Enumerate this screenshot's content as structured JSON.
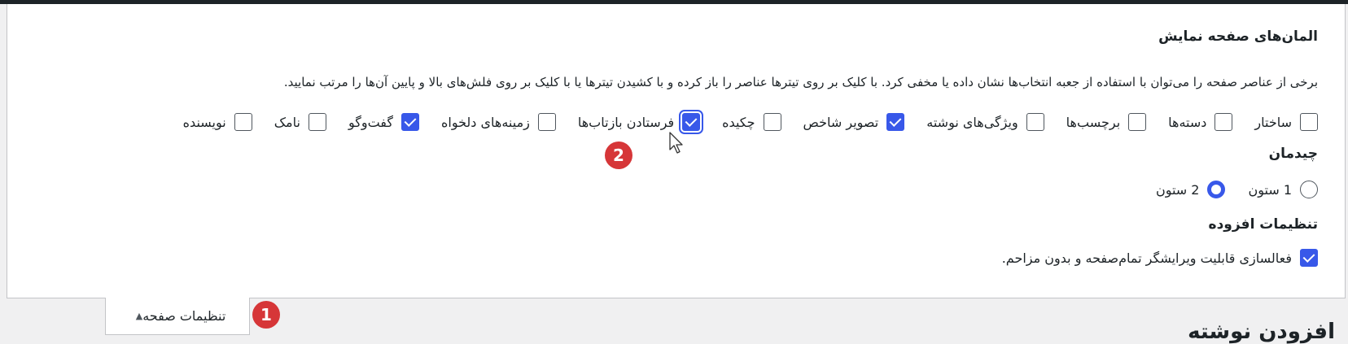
{
  "panel": {
    "title": "المان‌های صفحه نمایش",
    "description": "برخی از عناصر صفحه را می‌توان با استفاده از جعبه انتخاب‌ها نشان داده یا مخفی کرد. با کلیک بر روی تیترها عناصر را باز کرده و با کشیدن تیترها یا با کلیک بر روی فلش‌های بالا و پایین آن‌ها را مرتب نمایید.",
    "options": [
      {
        "label": "ساختار",
        "checked": false
      },
      {
        "label": "دسته‌ها",
        "checked": false
      },
      {
        "label": "برچسب‌ها",
        "checked": false
      },
      {
        "label": "ویژگی‌های نوشته",
        "checked": false
      },
      {
        "label": "تصویر شاخص",
        "checked": true
      },
      {
        "label": "چکیده",
        "checked": false
      },
      {
        "label": "فرستادن بازتاب‌ها",
        "checked": true
      },
      {
        "label": "زمینه‌های دلخواه",
        "checked": false
      },
      {
        "label": "گفت‌وگو",
        "checked": true
      },
      {
        "label": "نامک",
        "checked": false
      },
      {
        "label": "نویسنده",
        "checked": false
      }
    ],
    "layout_title": "چیدمان",
    "layout_options": [
      {
        "label": "1 ستون",
        "selected": false
      },
      {
        "label": "2 ستون",
        "selected": true
      }
    ],
    "advanced_title": "تنظیمات افزوده",
    "advanced_option": {
      "label": "فعالسازی قابلیت ویرایشگر تمام‌صفحه و بدون مزاحم.",
      "checked": true
    }
  },
  "tab": {
    "label": "تنظیمات صفحه",
    "arrow": "▲"
  },
  "badges": {
    "one": "1",
    "two": "2"
  },
  "page_heading": "افزودن نوشته",
  "colors": {
    "accent": "#3858e9",
    "badge": "#d63638",
    "topbar": "#1d2327"
  }
}
